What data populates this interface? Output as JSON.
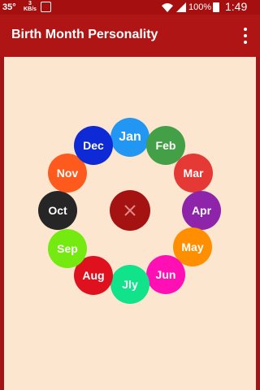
{
  "status_bar": {
    "temperature": "35°",
    "speed_value": "3",
    "speed_unit": "KB/s",
    "battery": "100%",
    "time": "1:49 p.m."
  },
  "app_bar": {
    "title": "Birth Month Personality",
    "menu_icon": "overflow-menu-icon"
  },
  "months": [
    {
      "key": "jan",
      "label": "Jan",
      "color": "#2196f3"
    },
    {
      "key": "feb",
      "label": "Feb",
      "color": "#43a047"
    },
    {
      "key": "mar",
      "label": "Mar",
      "color": "#e53935"
    },
    {
      "key": "apr",
      "label": "Apr",
      "color": "#8e24aa"
    },
    {
      "key": "may",
      "label": "May",
      "color": "#ff8f00"
    },
    {
      "key": "jun",
      "label": "Jun",
      "color": "#ff10b4"
    },
    {
      "key": "jly",
      "label": "Jly",
      "color": "#11e38a"
    },
    {
      "key": "aug",
      "label": "Aug",
      "color": "#e0111f"
    },
    {
      "key": "sep",
      "label": "Sep",
      "color": "#74ea11"
    },
    {
      "key": "oct",
      "label": "Oct",
      "color": "#262626"
    },
    {
      "key": "nov",
      "label": "Nov",
      "color": "#ff5a1e"
    },
    {
      "key": "dec",
      "label": "Dec",
      "color": "#0d2ad6"
    }
  ],
  "center_button": {
    "icon": "close-icon",
    "color": "#a51212"
  },
  "colors": {
    "status_bar": "#a50f0f",
    "app_bar": "#b01515",
    "background": "#fde6cf"
  }
}
